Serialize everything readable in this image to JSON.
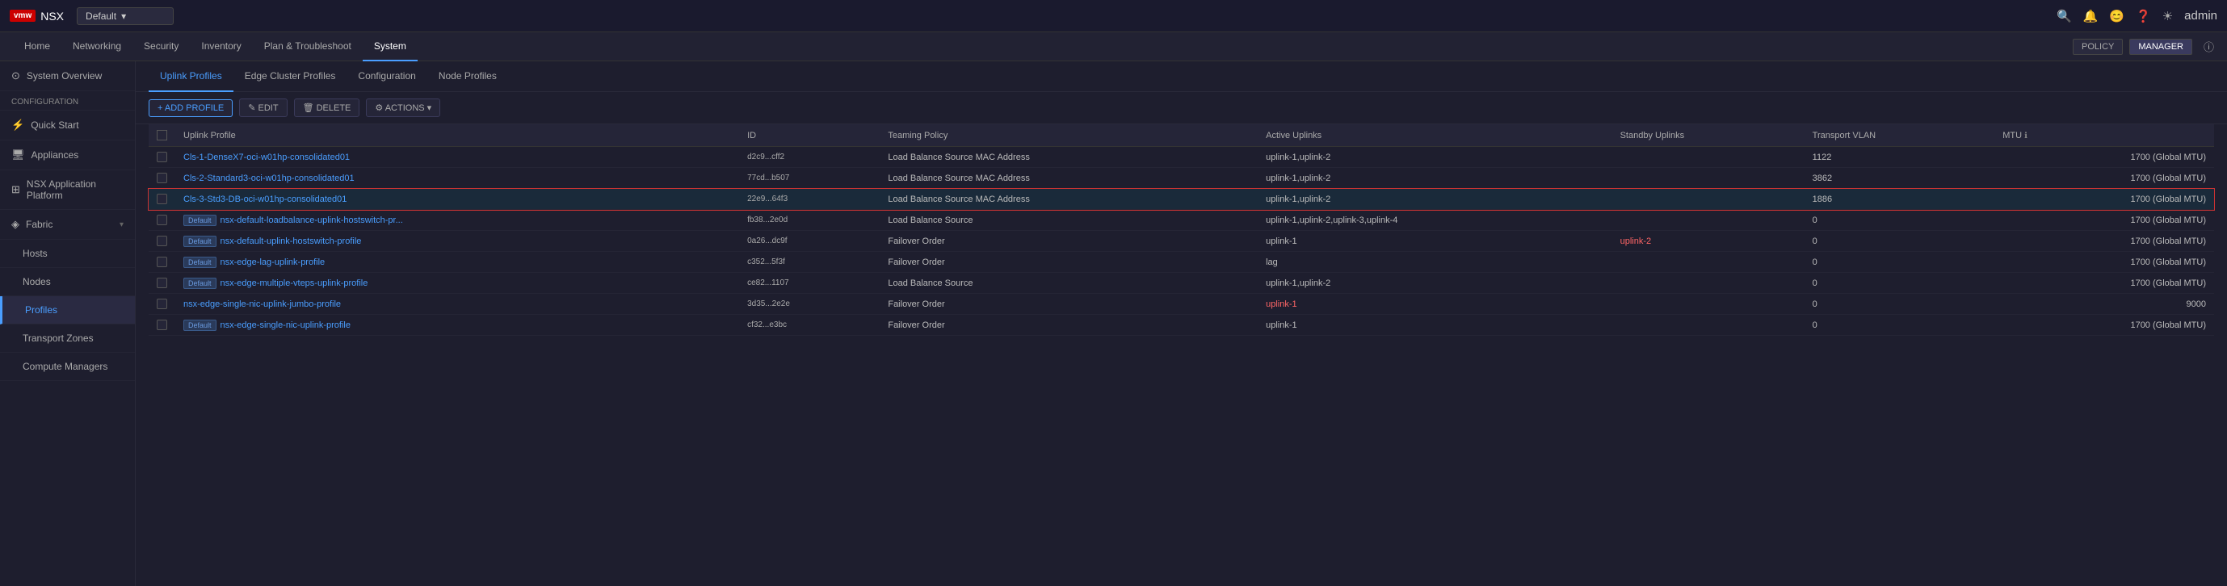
{
  "topbar": {
    "logo": "vmw",
    "app": "NSX",
    "dropdown": "Default",
    "icons": [
      "search",
      "bell",
      "user",
      "help",
      "theme",
      "admin"
    ]
  },
  "nav": {
    "items": [
      {
        "label": "Home",
        "active": false
      },
      {
        "label": "Networking",
        "active": false
      },
      {
        "label": "Security",
        "active": false
      },
      {
        "label": "Inventory",
        "active": false
      },
      {
        "label": "Plan & Troubleshoot",
        "active": false
      },
      {
        "label": "System",
        "active": true
      }
    ],
    "buttons": [
      "POLICY",
      "MANAGER"
    ]
  },
  "sidebar": {
    "overview": "System Overview",
    "config_label": "Configuration",
    "items": [
      {
        "label": "Quick Start",
        "icon": "⚡"
      },
      {
        "label": "Appliances",
        "icon": "🖥"
      },
      {
        "label": "NSX Application Platform",
        "icon": "⊞"
      },
      {
        "label": "Fabric",
        "icon": "◈",
        "has_children": true
      },
      {
        "label": "Hosts",
        "icon": "",
        "sub": true
      },
      {
        "label": "Nodes",
        "icon": "",
        "sub": true
      },
      {
        "label": "Profiles",
        "icon": "",
        "sub": true,
        "active": true
      },
      {
        "label": "Transport Zones",
        "icon": "",
        "sub": true
      },
      {
        "label": "Compute Managers",
        "icon": "",
        "sub": true
      }
    ]
  },
  "tabs": [
    {
      "label": "Uplink Profiles",
      "active": true
    },
    {
      "label": "Edge Cluster Profiles",
      "active": false
    },
    {
      "label": "Configuration",
      "active": false
    },
    {
      "label": "Node Profiles",
      "active": false
    }
  ],
  "toolbar": {
    "add": "+ ADD PROFILE",
    "edit": "✎ EDIT",
    "delete": "🗑 DELETE",
    "actions": "⚙ ACTIONS ▾"
  },
  "table": {
    "columns": [
      {
        "label": "",
        "key": "checkbox"
      },
      {
        "label": "Uplink Profile",
        "key": "name"
      },
      {
        "label": "ID",
        "key": "id"
      },
      {
        "label": "Teaming Policy",
        "key": "teaming"
      },
      {
        "label": "Active Uplinks",
        "key": "active"
      },
      {
        "label": "Standby Uplinks",
        "key": "standby"
      },
      {
        "label": "Transport VLAN",
        "key": "vlan"
      },
      {
        "label": "MTU ℹ",
        "key": "mtu"
      }
    ],
    "rows": [
      {
        "name": "Cls-1-DenseX7-oci-w01hp-consolidated01",
        "default": false,
        "id": "d2c9...cff2",
        "teaming": "Load Balance Source MAC Address",
        "active": "uplink-1,uplink-2",
        "standby": "",
        "vlan": "1122",
        "mtu": "1700 (Global MTU)",
        "selected": false
      },
      {
        "name": "Cls-2-Standard3-oci-w01hp-consolidated01",
        "default": false,
        "id": "77cd...b507",
        "teaming": "Load Balance Source MAC Address",
        "active": "uplink-1,uplink-2",
        "standby": "",
        "vlan": "3862",
        "mtu": "1700 (Global MTU)",
        "selected": false
      },
      {
        "name": "Cls-3-Std3-DB-oci-w01hp-consolidated01",
        "default": false,
        "id": "22e9...64f3",
        "teaming": "Load Balance Source MAC Address",
        "active": "uplink-1,uplink-2",
        "standby": "",
        "vlan": "1886",
        "mtu": "1700 (Global MTU)",
        "selected": true
      },
      {
        "name": "nsx-default-loadbalance-uplink-hostswitch-pr...",
        "default": true,
        "id": "fb38...2e0d",
        "teaming": "Load Balance Source",
        "active": "uplink-1,uplink-2,uplink-3,uplink-4",
        "standby": "",
        "vlan": "0",
        "mtu": "1700 (Global MTU)",
        "selected": false
      },
      {
        "name": "nsx-default-uplink-hostswitch-profile",
        "default": true,
        "id": "0a26...dc9f",
        "teaming": "Failover Order",
        "active": "uplink-1",
        "standby": "uplink-2",
        "vlan": "0",
        "mtu": "1700 (Global MTU)",
        "selected": false
      },
      {
        "name": "nsx-edge-lag-uplink-profile",
        "default": true,
        "id": "c352...5f3f",
        "teaming": "Failover Order",
        "active": "lag",
        "standby": "",
        "vlan": "0",
        "mtu": "1700 (Global MTU)",
        "selected": false
      },
      {
        "name": "nsx-edge-multiple-vteps-uplink-profile",
        "default": true,
        "id": "ce82...1107",
        "teaming": "Load Balance Source",
        "active": "uplink-1,uplink-2",
        "standby": "",
        "vlan": "0",
        "mtu": "1700 (Global MTU)",
        "selected": false
      },
      {
        "name": "nsx-edge-single-nic-uplink-jumbo-profile",
        "default": false,
        "id": "3d35...2e2e",
        "teaming": "Failover Order",
        "active": "uplink-1",
        "standby": "",
        "vlan": "0",
        "mtu": "9000",
        "selected": false
      },
      {
        "name": "nsx-edge-single-nic-uplink-profile",
        "default": true,
        "id": "cf32...e3bc",
        "teaming": "Failover Order",
        "active": "uplink-1",
        "standby": "",
        "vlan": "0",
        "mtu": "1700 (Global MTU)",
        "selected": false
      }
    ]
  }
}
